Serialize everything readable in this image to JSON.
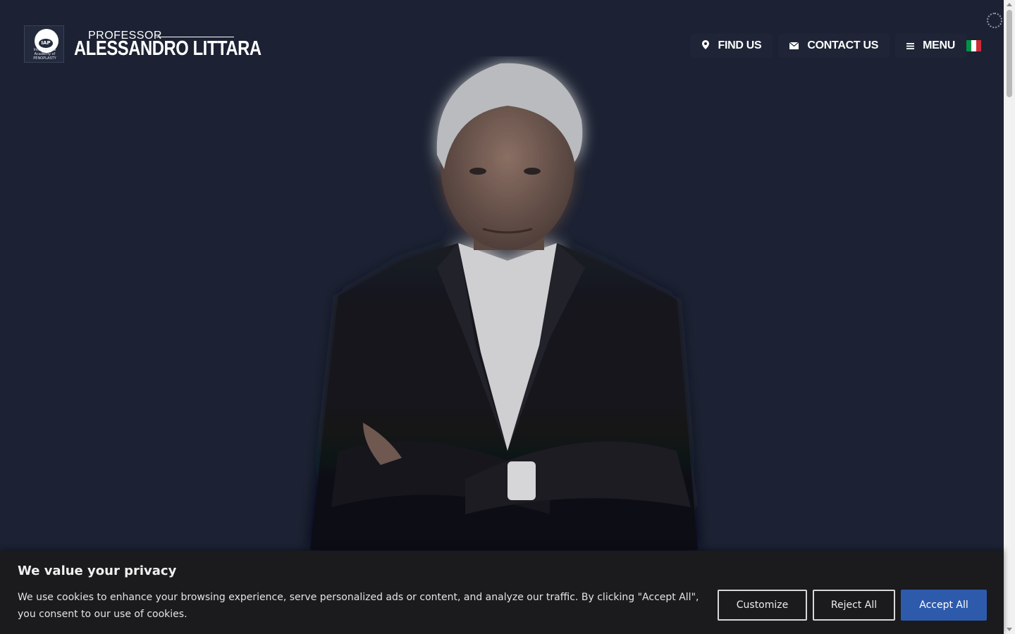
{
  "header": {
    "logo": {
      "badge_text": "IAP",
      "badge_subtext": "International Academy of PENOPLASTY",
      "prefix": "PROFESSOR",
      "name": "ALESSANDRO LITTARA"
    },
    "nav": {
      "find_us": "FIND US",
      "contact_us": "CONTACT US",
      "menu": "MENU"
    },
    "flag_colors": [
      "#009246",
      "#ffffff",
      "#ce2b37"
    ]
  },
  "cookie_banner": {
    "title": "We value your privacy",
    "description": "We use cookies to enhance your browsing experience, serve personalized ads or content, and analyze our traffic. By clicking \"Accept All\", you consent to our use of cookies.",
    "customize_label": "Customize",
    "reject_label": "Reject All",
    "accept_label": "Accept All",
    "accent_color": "#2e5aac"
  },
  "colors": {
    "background": "#1c2233",
    "banner_bg": "#1b1b1d"
  }
}
